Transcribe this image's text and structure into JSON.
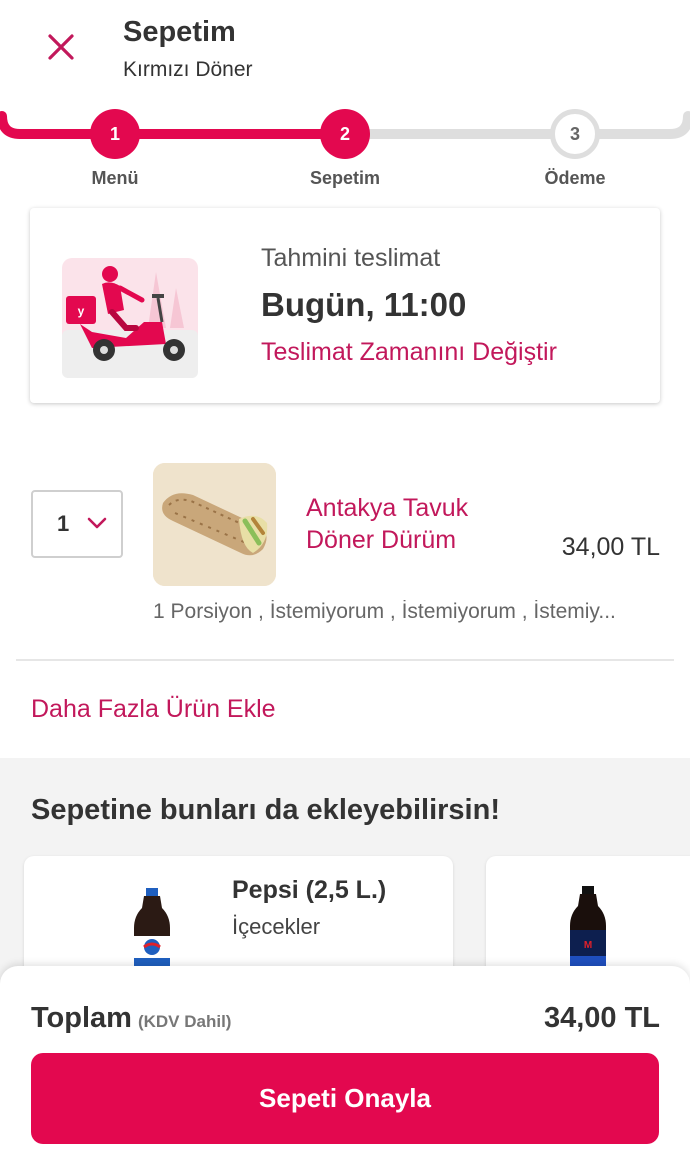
{
  "header": {
    "title": "Sepetim",
    "subtitle": "Kırmızı Döner",
    "close_icon": "close-icon"
  },
  "stepper": {
    "steps": [
      {
        "number": "1",
        "label": "Menü",
        "state": "done"
      },
      {
        "number": "2",
        "label": "Sepetim",
        "state": "active"
      },
      {
        "number": "3",
        "label": "Ödeme",
        "state": "pending"
      }
    ],
    "active_color": "#e3084f",
    "inactive_color": "#dedede"
  },
  "delivery": {
    "label": "Tahmini teslimat",
    "time": "Bugün, 11:00",
    "change_link": "Teslimat Zamanını Değiştir",
    "illustration": "courier-scooter-illustration"
  },
  "cart": {
    "items": [
      {
        "quantity": "1",
        "name": "Antakya Tavuk Döner Dürüm",
        "price": "34,00 TL",
        "options": "1 Porsiyon , İstemiyorum , İstemiyorum , İstemiy...",
        "image": "wrap-image"
      }
    ],
    "add_more": "Daha Fazla Ürün Ekle"
  },
  "suggestions": {
    "title": "Sepetine bunları da ekleyebilirsin!",
    "items": [
      {
        "name": "Pepsi (2,5 L.)",
        "category": "İçecekler",
        "image": "pepsi-bottle-image"
      },
      {
        "name": "",
        "category": "",
        "image": "pepsi-max-bottle-image"
      }
    ]
  },
  "footer": {
    "total_label": "Toplam",
    "total_note": "(KDV Dahil)",
    "total_value": "34,00 TL",
    "confirm_button": "Sepeti Onayla"
  },
  "colors": {
    "brand": "#e3084f",
    "link": "#c2185b"
  }
}
